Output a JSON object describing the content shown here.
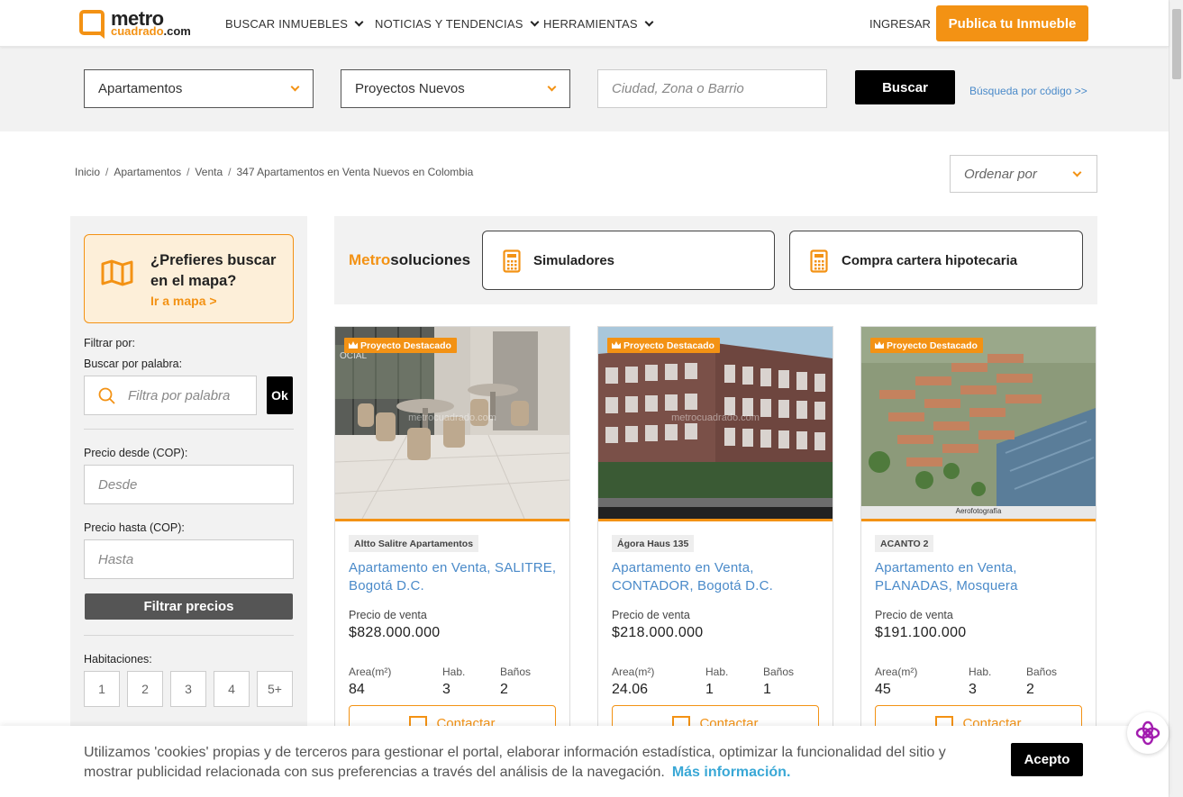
{
  "header": {
    "logo_top": "metro",
    "logo_bottom_brand": "cuadrado",
    "logo_bottom_tld": ".com",
    "nav": [
      "BUSCAR INMUEBLES",
      "NOTICIAS Y TENDENCIAS",
      "HERRAMIENTAS"
    ],
    "login": "INGRESAR",
    "publish": "Publica tu Inmueble"
  },
  "search": {
    "property_type": "Apartamentos",
    "offer_type": "Proyectos Nuevos",
    "city_placeholder": "Ciudad, Zona o Barrio",
    "search_button": "Buscar",
    "code_search": "Búsqueda por código >>"
  },
  "breadcrumb": [
    "Inicio",
    "Apartamentos",
    "Venta",
    "347 Apartamentos en Venta Nuevos en Colombia"
  ],
  "sort": {
    "placeholder": "Ordenar por"
  },
  "sidebar": {
    "map_title": "¿Prefieres buscar en el mapa?",
    "map_link": "Ir a mapa >",
    "filter_by": "Filtrar por:",
    "keyword_label": "Buscar por palabra:",
    "keyword_placeholder": "Filtra por palabra",
    "ok": "Ok",
    "price_from_label": "Precio desde (COP):",
    "price_from_placeholder": "Desde",
    "price_to_label": "Precio hasta (COP):",
    "price_to_placeholder": "Hasta",
    "filter_button": "Filtrar precios",
    "rooms_label": "Habitaciones:",
    "rooms": [
      "1",
      "2",
      "3",
      "4",
      "5+"
    ]
  },
  "metrosoluciones": {
    "title_accent": "Metro",
    "title_rest": "soluciones",
    "cards": [
      "Simuladores",
      "Compra cartera hipotecaria"
    ]
  },
  "listings": [
    {
      "badge": "Proyecto Destacado",
      "project": "Altto Salitre Apartamentos",
      "title": "Apartamento en Venta, SALITRE, Bogotá D.C.",
      "price_label": "Precio de venta",
      "price": "$828.000.000",
      "area_label": "Area(m²)",
      "area": "84",
      "rooms_label": "Hab.",
      "rooms": "3",
      "baths_label": "Baños",
      "baths": "2",
      "contact": "Contactar",
      "watermark": "metrocuadrado.com",
      "caption": ""
    },
    {
      "badge": "Proyecto Destacado",
      "project": "Ágora Haus 135",
      "title": "Apartamento en Venta, CONTADOR, Bogotá D.C.",
      "price_label": "Precio de venta",
      "price": "$218.000.000",
      "area_label": "Area(m²)",
      "area": "24.06",
      "rooms_label": "Hab.",
      "rooms": "1",
      "baths_label": "Baños",
      "baths": "1",
      "contact": "Contactar",
      "watermark": "metrocuadrado.com",
      "caption": ""
    },
    {
      "badge": "Proyecto Destacado",
      "project": "ACANTO 2",
      "title": "Apartamento en Venta, PLANADAS, Mosquera",
      "price_label": "Precio de venta",
      "price": "$191.100.000",
      "area_label": "Area(m²)",
      "area": "45",
      "rooms_label": "Hab.",
      "rooms": "3",
      "baths_label": "Baños",
      "baths": "2",
      "contact": "Contactar",
      "watermark": "",
      "caption": "Aerofotografía"
    }
  ],
  "cookie": {
    "text": "Utilizamos 'cookies' propias y de terceros para gestionar el portal, elaborar información estadística, optimizar la funcionalidad del sitio y mostrar publicidad relacionada con sus preferencias a través del análisis de la navegación.",
    "more": "Más información.",
    "accept": "Acepto"
  },
  "colors": {
    "accent": "#f39214",
    "link": "#4a8ac9",
    "dark": "#000000",
    "panel": "#f2f2f2"
  },
  "icons": [
    "chevron-down-icon",
    "map-icon",
    "search-icon",
    "calculator-icon",
    "crown-icon",
    "envelope-icon",
    "chat-icon"
  ]
}
